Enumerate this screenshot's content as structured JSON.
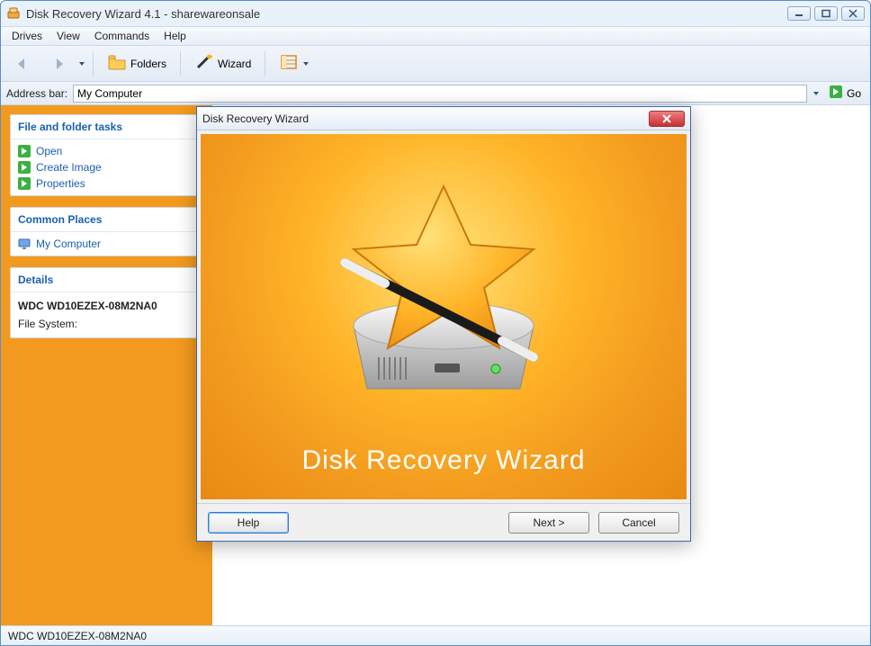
{
  "window": {
    "title": "Disk Recovery Wizard 4.1 - sharewareonsale"
  },
  "menu": {
    "items": [
      "Drives",
      "View",
      "Commands",
      "Help"
    ]
  },
  "toolbar": {
    "folders_label": "Folders",
    "wizard_label": "Wizard"
  },
  "addressbar": {
    "label": "Address bar:",
    "value": "My Computer",
    "go_label": "Go"
  },
  "sidebar": {
    "file_tasks": {
      "title": "File and folder tasks",
      "items": [
        "Open",
        "Create Image",
        "Properties"
      ]
    },
    "common_places": {
      "title": "Common Places",
      "items": [
        "My Computer"
      ]
    },
    "details": {
      "title": "Details",
      "device_name": "WDC WD10EZEX-08M2NA0",
      "fs_label": "File System:",
      "fs_value": ""
    }
  },
  "statusbar": {
    "text": "WDC WD10EZEX-08M2NA0"
  },
  "dialog": {
    "title": "Disk Recovery Wizard",
    "heading": "Disk Recovery Wizard",
    "help_label": "Help",
    "next_label": "Next >",
    "cancel_label": "Cancel"
  }
}
